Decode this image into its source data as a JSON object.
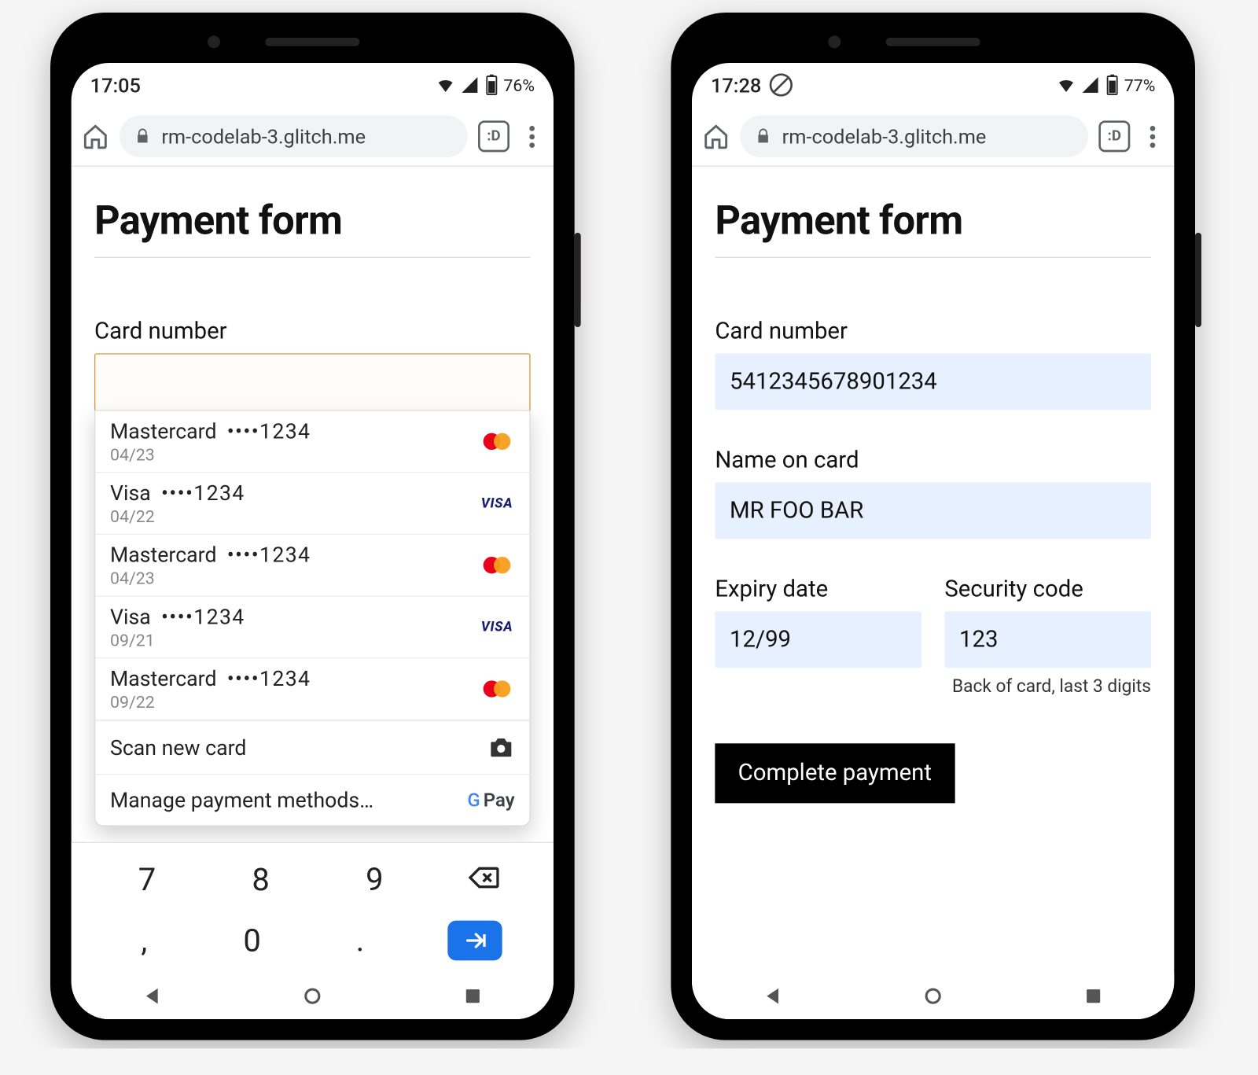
{
  "left": {
    "status": {
      "time": "17:05",
      "battery": "76%"
    },
    "browser": {
      "url": "rm-codelab-3.glitch.me",
      "tabs": ":D"
    },
    "page": {
      "title": "Payment form",
      "card_label": "Card number"
    },
    "autofill": {
      "cards": [
        {
          "brand": "mastercard",
          "name": "Mastercard",
          "mask": "••••1234",
          "exp": "04/23"
        },
        {
          "brand": "visa",
          "name": "Visa",
          "mask": "••••1234",
          "exp": "04/22"
        },
        {
          "brand": "mastercard",
          "name": "Mastercard",
          "mask": "••••1234",
          "exp": "04/23"
        },
        {
          "brand": "visa",
          "name": "Visa",
          "mask": "••••1234",
          "exp": "09/21"
        },
        {
          "brand": "mastercard",
          "name": "Mastercard",
          "mask": "••••1234",
          "exp": "09/22"
        }
      ],
      "scan_label": "Scan new card",
      "manage_label": "Manage payment methods…",
      "gpay_text": "Pay"
    },
    "keyboard": {
      "r1": [
        "7",
        "8",
        "9"
      ],
      "r2": [
        ",",
        "0",
        "."
      ]
    }
  },
  "right": {
    "status": {
      "time": "17:28",
      "battery": "77%"
    },
    "browser": {
      "url": "rm-codelab-3.glitch.me",
      "tabs": ":D"
    },
    "page": {
      "title": "Payment form",
      "card_label": "Card number",
      "card_value": "5412345678901234",
      "name_label": "Name on card",
      "name_value": "MR FOO BAR",
      "exp_label": "Expiry date",
      "exp_value": "12/99",
      "cvc_label": "Security code",
      "cvc_value": "123",
      "cvc_hint": "Back of card, last 3 digits",
      "submit_label": "Complete payment"
    }
  }
}
